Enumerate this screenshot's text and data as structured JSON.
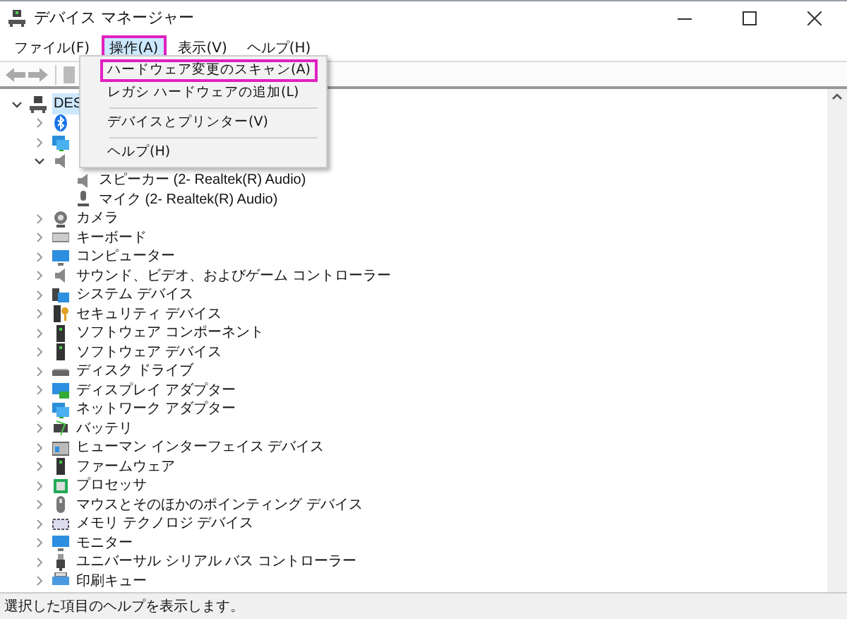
{
  "window": {
    "title": "デバイス マネージャー"
  },
  "menu_bar": [
    {
      "label": "ファイル(F)",
      "selected": false
    },
    {
      "label": "操作(A)",
      "selected": true
    },
    {
      "label": "表示(V)",
      "selected": false
    },
    {
      "label": "ヘルプ(H)",
      "selected": false
    }
  ],
  "dropdown": [
    {
      "kind": "item",
      "label": "ハードウェア変更のスキャン(A)",
      "highlighted": true
    },
    {
      "kind": "item",
      "label": "レガシ ハードウェアの追加(L)",
      "highlighted": false
    },
    {
      "kind": "separator"
    },
    {
      "kind": "item",
      "label": "デバイスとプリンター(V)",
      "highlighted": false
    },
    {
      "kind": "separator"
    },
    {
      "kind": "item",
      "label": "ヘルプ(H)",
      "highlighted": false
    }
  ],
  "tree": {
    "label": "DES",
    "kind": "computer",
    "selected": true,
    "expanded": true,
    "children": [
      {
        "kind": "bluetooth",
        "expanded": false
      },
      {
        "kind": "network",
        "expanded": false
      },
      {
        "kind": "speaker",
        "expanded": true,
        "children": [
          {
            "label": "スピーカー (2- Realtek(R) Audio)",
            "kind": "speaker"
          },
          {
            "label": "マイク (2- Realtek(R) Audio)",
            "kind": "mic"
          }
        ]
      },
      {
        "label": "カメラ",
        "kind": "camera",
        "expanded": false
      },
      {
        "label": "キーボード",
        "kind": "keyboard",
        "expanded": false
      },
      {
        "label": "コンピューター",
        "kind": "monitor",
        "expanded": false
      },
      {
        "label": "サウンド、ビデオ、およびゲーム コントローラー",
        "kind": "speaker",
        "expanded": false
      },
      {
        "label": "システム デバイス",
        "kind": "system",
        "expanded": false
      },
      {
        "label": "セキュリティ デバイス",
        "kind": "security",
        "expanded": false
      },
      {
        "label": "ソフトウェア コンポーネント",
        "kind": "device",
        "expanded": false
      },
      {
        "label": "ソフトウェア デバイス",
        "kind": "device",
        "expanded": false
      },
      {
        "label": "ディスク ドライブ",
        "kind": "disk",
        "expanded": false
      },
      {
        "label": "ディスプレイ アダプター",
        "kind": "display",
        "expanded": false
      },
      {
        "label": "ネットワーク アダプター",
        "kind": "network",
        "expanded": false
      },
      {
        "label": "バッテリ",
        "kind": "battery",
        "expanded": false
      },
      {
        "label": "ヒューマン インターフェイス デバイス",
        "kind": "hid",
        "expanded": false
      },
      {
        "label": "ファームウェア",
        "kind": "device",
        "expanded": false
      },
      {
        "label": "プロセッサ",
        "kind": "chip",
        "expanded": false
      },
      {
        "label": "マウスとそのほかのポインティング デバイス",
        "kind": "mouse",
        "expanded": false
      },
      {
        "label": "メモリ テクノロジ デバイス",
        "kind": "memory",
        "expanded": false
      },
      {
        "label": "モニター",
        "kind": "monitor",
        "expanded": false
      },
      {
        "label": "ユニバーサル シリアル バス コントローラー",
        "kind": "usb",
        "expanded": false
      },
      {
        "label": "印刷キュー",
        "kind": "printer",
        "expanded": false
      }
    ]
  },
  "status_bar": {
    "text": "選択した項目のヘルプを表示します。"
  }
}
